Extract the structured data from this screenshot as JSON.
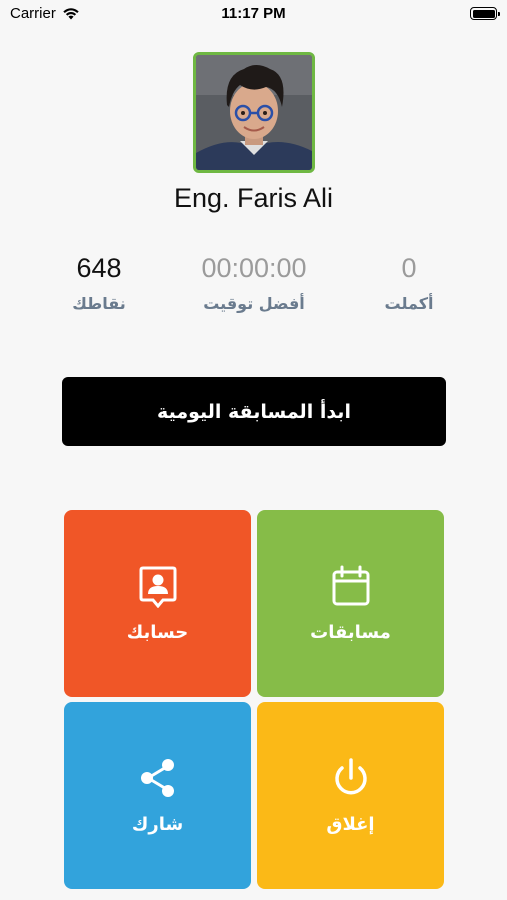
{
  "status_bar": {
    "carrier": "Carrier",
    "time": "11:17 PM"
  },
  "profile": {
    "name": "Eng. Faris Ali",
    "avatar_border_color": "#6fb843"
  },
  "stats": {
    "points": {
      "value": "648",
      "label": "نقاطك"
    },
    "best_time": {
      "value": "00:00:00",
      "label": "أفضل توقيت"
    },
    "completed": {
      "value": "0",
      "label": "أكملت"
    }
  },
  "start_button": {
    "label": "ابدأ المسابقة اليومية"
  },
  "tiles": {
    "account": {
      "label": "حسابك",
      "icon": "profile-badge-icon",
      "color": "#f05627"
    },
    "contests": {
      "label": "مسابقات",
      "icon": "calendar-icon",
      "color": "#86bc48"
    },
    "share": {
      "label": "شارك",
      "icon": "share-icon",
      "color": "#32a3dc"
    },
    "close": {
      "label": "إغلاق",
      "icon": "power-icon",
      "color": "#fbb917"
    }
  }
}
